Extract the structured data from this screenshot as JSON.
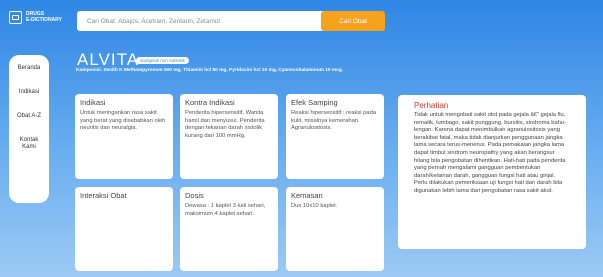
{
  "logo": {
    "line1": "DRUGS",
    "line2": "E-DICTIONARY"
  },
  "search": {
    "placeholder": "Cari Obat: Abajos, Acetram, Zentarin, Zetamol",
    "button": "Cari Obat"
  },
  "sidebar": {
    "items": [
      {
        "label": "Beranda"
      },
      {
        "label": "Indikasi"
      },
      {
        "label": "Obat A-Z"
      },
      {
        "label": "Kontak Kami"
      }
    ]
  },
  "drug": {
    "name": "ALVITA",
    "badge": "analgesik non narkotik",
    "composition": "Komposisi: Zenith K Methampyronum 500 mg, Thiamini hcl 50 mg, Pyridoxini hcl 10 mg, Cyanocobalaminum 10 mcg."
  },
  "cards": [
    {
      "title": "Indikasi",
      "body": "Untuk meringankan rasa sakit yang berat yang disebabkan oleh neuritis dan neuralgia."
    },
    {
      "title": "Kontra Indikasi",
      "body": "Penderita hipersensitif. Wanita hamil dan menyusui. Penderita dengan tekanan darah sistolik kurang dari 100 mmHg."
    },
    {
      "title": "Efek Samping",
      "body": "Reaksi hipersensitif : reaksi pada kulit, misalnya kemerahan. Agranulositosis."
    },
    {
      "title": "Interaksi Obat",
      "body": ""
    },
    {
      "title": "Dosis",
      "body": "Dewasa : 1 kaplet 3 kali sehari, maksimum 4 kaplet sehari."
    },
    {
      "title": "Kemasan",
      "body": "Dus 10x10 kaplet."
    }
  ],
  "warning": {
    "title": "Perhatian",
    "body": "Tidak untuk mengobati sakit otot pada gejala â€\" gejala flu, rematik, lumbago, sakit punggung, bursitis, sindroma bahu-lengan. Karena dapat menimbulkan agranulositosis yang berakibat fatal, maka tidak dianjurkan penggunaan jangka lama secara terus-menerus. Pada pemakaian jangka lama dapat timbul sindrom neuropathy yang akan berangsur hilang bila pengobatan dihentikan. Hati-hati pada penderita yang pernah mengalami gangguan pembentukan darah/kelainan darah, gangguan fungsi hati atau ginjal. Perlu dilakukan pemeriksaan uji fungsi hati dan darah bila digunakan lebih lama dari pengobatan rasa sakit akut."
  }
}
